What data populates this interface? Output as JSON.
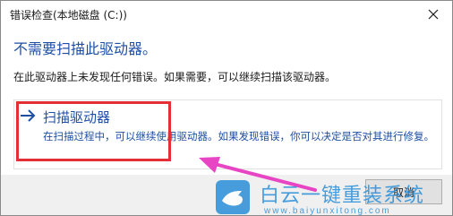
{
  "window": {
    "title": "错误检查(本地磁盘 (C:))"
  },
  "main": {
    "heading": "不需要扫描此驱动器。",
    "description": "在此驱动器上未发现任何错误。如果需要，可以继续扫描该驱动器。"
  },
  "option": {
    "title": "扫描驱动器",
    "description": "在扫描过程中，可以继续使用驱动器。如果发现错误，你可以决定是否对其进行修复。"
  },
  "footer": {
    "cancel_label": "取消"
  },
  "watermark": {
    "brand": "白云一键重装系统",
    "url": "www.baiyunxitong.com"
  },
  "colors": {
    "accent": "#1e4fa3",
    "highlight": "#e32f38",
    "annotation_arrow": "#e845c4",
    "footer_bg": "#f0f0f0"
  }
}
